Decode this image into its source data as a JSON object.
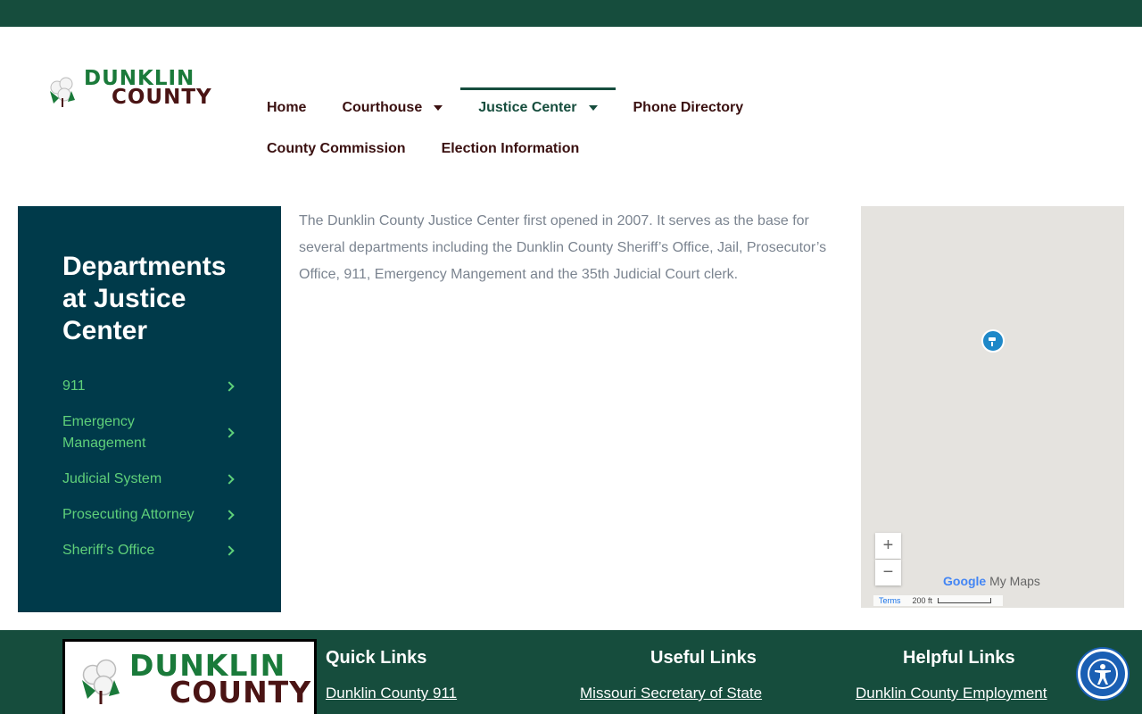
{
  "header": {
    "logo_line1": "DUNKLIN",
    "logo_line2": "COUNTY"
  },
  "nav": {
    "home": "Home",
    "courthouse": "Courthouse",
    "justice_center": "Justice Center",
    "phone_directory": "Phone Directory",
    "county_commission": "County Commission",
    "election_information": "Election Information"
  },
  "sidebar": {
    "title": "Departments at Justice Center",
    "items": [
      {
        "label": "911"
      },
      {
        "label": "Emergency Management"
      },
      {
        "label": "Judicial System"
      },
      {
        "label": "Prosecuting Attorney"
      },
      {
        "label": "Sheriff’s Office"
      }
    ]
  },
  "main": {
    "intro": "The Dunklin County Justice Center first opened in 2007. It serves as the base for several departments including the Dunklin County Sheriff’s Office, Jail, Prosecutor’s Office, 911, Emergency Mangement and the 35th Judicial Court clerk."
  },
  "map": {
    "zoom_in": "+",
    "zoom_out": "−",
    "brand_google": "Google",
    "brand_mymaps": "My Maps",
    "terms": "Terms",
    "scale": "200 ft",
    "pin_icon": "map-marker-icon"
  },
  "footer": {
    "logo_line1": "DUNKLIN",
    "logo_line2": "COUNTY",
    "quick_links_heading": "Quick Links",
    "quick_link_1": "Dunklin County 911",
    "useful_links_heading": "Useful Links",
    "useful_link_1": "Missouri Secretary of State",
    "helpful_links_heading": "Helpful Links",
    "helpful_link_1": "Dunklin County Employment"
  },
  "colors": {
    "brand_green": "#164d3d",
    "sidebar_bg": "#003a4a",
    "sidebar_link": "#5fd07a",
    "nav_text": "#3a1010",
    "accessibility_blue": "#1a5fb4"
  }
}
